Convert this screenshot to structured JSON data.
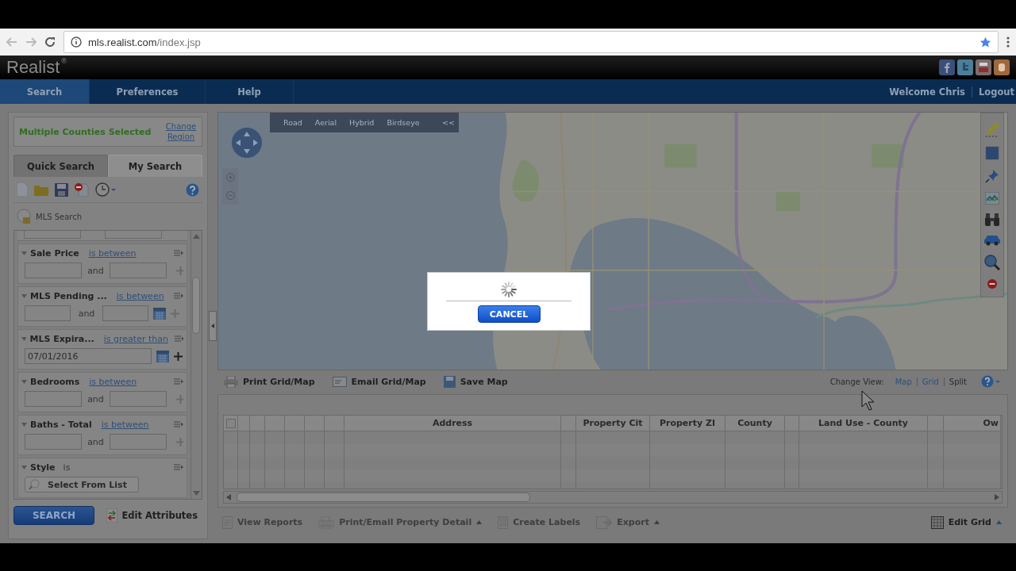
{
  "browser": {
    "url_host": "mls.realist.com",
    "url_path": "/index.jsp"
  },
  "header": {
    "logo": "Realist",
    "logo_mark": "®"
  },
  "nav": {
    "tabs": [
      {
        "label": "Search",
        "selected": true
      },
      {
        "label": "Preferences",
        "selected": false
      },
      {
        "label": "Help",
        "selected": false
      }
    ],
    "welcome": "Welcome Chris",
    "logout": "Logout"
  },
  "search_panel": {
    "region": {
      "label": "Multiple Counties Selected",
      "link": "Change Region"
    },
    "tabs": [
      {
        "label": "Quick Search",
        "selected": false
      },
      {
        "label": "My Search",
        "selected": true
      }
    ],
    "saved_search": "MLS Search",
    "criteria": [
      {
        "kind": "range",
        "name": "Sale Price",
        "operator": "is between",
        "joiner": "and",
        "add_enabled": false
      },
      {
        "kind": "date_range",
        "name": "MLS Pending ...",
        "operator": "is between",
        "joiner": "and",
        "add_enabled": false
      },
      {
        "kind": "date",
        "name": "MLS Expira...",
        "operator": "is greater than",
        "value": "07/01/2016",
        "add_enabled": true
      },
      {
        "kind": "range",
        "name": "Bedrooms",
        "operator": "is between",
        "joiner": "and",
        "add_enabled": false
      },
      {
        "kind": "range",
        "name": "Baths - Total",
        "operator": "is between",
        "joiner": "and",
        "add_enabled": false
      },
      {
        "kind": "list",
        "name": "Style",
        "operator": "is",
        "button": "Select From List"
      }
    ],
    "search_button": "SEARCH",
    "edit_attributes": "Edit Attributes"
  },
  "map": {
    "map_types": [
      "Road",
      "Aerial",
      "Hybrid",
      "Birdseye"
    ],
    "collapse": "<<"
  },
  "map_toolbar": {
    "actions": [
      "Print Grid/Map",
      "Email Grid/Map",
      "Save Map"
    ],
    "change_view": "Change View:",
    "views": [
      {
        "label": "Map",
        "selected": false
      },
      {
        "label": "Grid",
        "selected": false
      },
      {
        "label": "Split",
        "selected": true
      }
    ]
  },
  "grid": {
    "select_all_checked": false,
    "columns": [
      "",
      "",
      "",
      "",
      "",
      "",
      "",
      "Address",
      "",
      "Property Cit",
      "Property ZI",
      "County",
      "",
      "Land Use - County",
      "",
      "Ow"
    ]
  },
  "bottom_toolbar": {
    "actions": [
      {
        "label": "View Reports",
        "disabled": true,
        "menu": false
      },
      {
        "label": "Print/Email Property Detail",
        "disabled": true,
        "menu": true
      },
      {
        "label": "Create Labels",
        "disabled": true,
        "menu": false
      },
      {
        "label": "Export",
        "disabled": true,
        "menu": true
      }
    ],
    "edit_grid": "Edit Grid"
  },
  "dialog": {
    "cancel": "CANCEL"
  }
}
